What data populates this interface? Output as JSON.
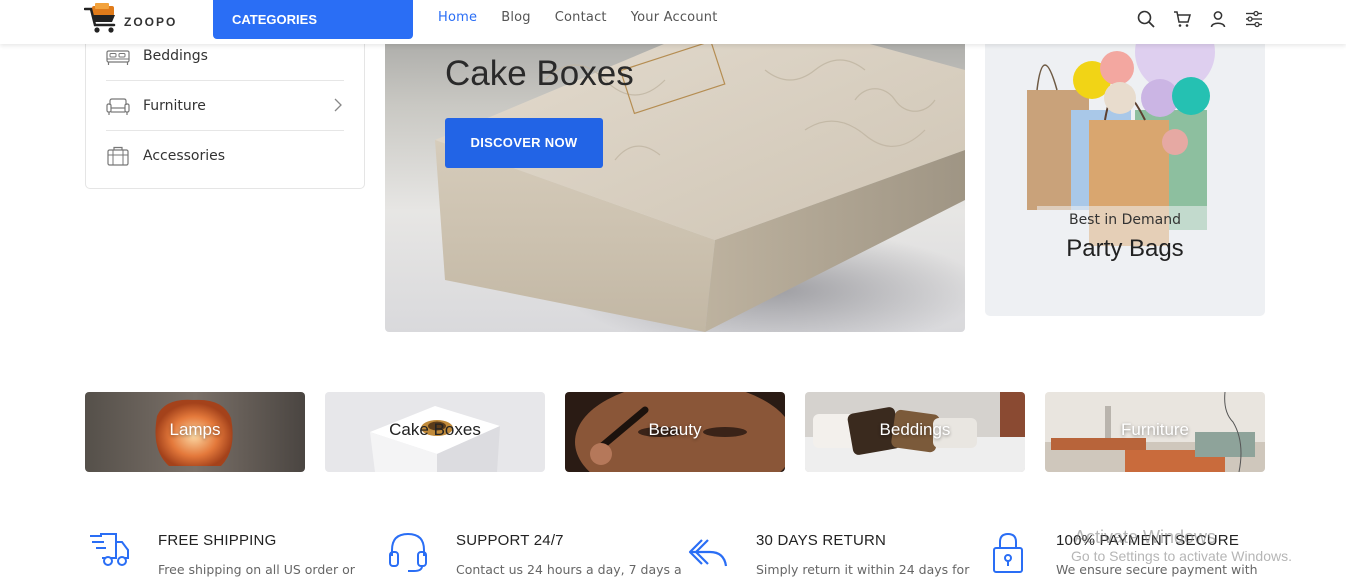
{
  "header": {
    "logo_text": "ZOOPO",
    "categories_button": "CATEGORIES",
    "nav": [
      "Home",
      "Blog",
      "Contact",
      "Your Account"
    ],
    "active_nav": "Home",
    "icons": [
      "search-icon",
      "cart-icon",
      "user-icon",
      "settings-sliders-icon"
    ],
    "accent_color": "#2a6ef5"
  },
  "sidebar": {
    "items": [
      {
        "label": "Beddings",
        "icon": "bed-icon"
      },
      {
        "label": "Furniture",
        "icon": "sofa-icon",
        "has_submenu": true
      },
      {
        "label": "Accessories",
        "icon": "bag-icon"
      }
    ]
  },
  "hero": {
    "title": "Cake Boxes",
    "button": "DISCOVER NOW",
    "button_color": "#2264e6"
  },
  "promo": {
    "eyebrow": "Best in Demand",
    "title": "Party Bags"
  },
  "tiles": [
    {
      "label": "Lamps"
    },
    {
      "label": "Cake Boxes"
    },
    {
      "label": "Beauty"
    },
    {
      "label": "Beddings"
    },
    {
      "label": "Furniture"
    }
  ],
  "features": [
    {
      "title": "FREE SHIPPING",
      "desc": "Free shipping on all US order or",
      "icon": "truck-icon"
    },
    {
      "title": "SUPPORT 24/7",
      "desc": "Contact us 24 hours a day, 7 days a",
      "icon": "headphones-icon"
    },
    {
      "title": "30 DAYS RETURN",
      "desc": "Simply return it within 24 days for",
      "icon": "return-arrow-icon"
    },
    {
      "title": "100% PAYMENT SECURE",
      "desc": "We ensure secure payment with",
      "icon": "lock-icon"
    }
  ],
  "watermark": {
    "line1": "Activate Windows",
    "line2": "Go to Settings to activate Windows."
  }
}
